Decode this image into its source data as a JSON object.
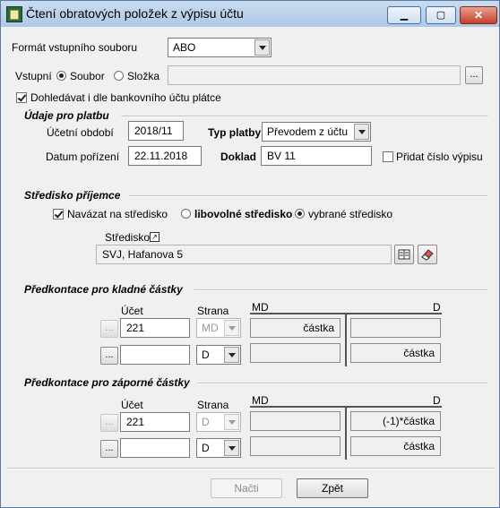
{
  "window": {
    "title": "Čtení obratových položek z výpisu účtu"
  },
  "format": {
    "label": "Formát vstupního souboru",
    "value": "ABO"
  },
  "input": {
    "label": "Vstupní",
    "opt_file": "Soubor",
    "opt_folder": "Složka",
    "path": "",
    "browse": "..."
  },
  "lookup_bank": {
    "label": "Dohledávat i dle bankovního účtu plátce",
    "checked": true
  },
  "payment": {
    "section": "Údaje pro platbu",
    "period_label": "Účetní období",
    "period": "2018/11",
    "type_label": "Typ platby",
    "type": "Převodem z účtu",
    "date_label": "Datum pořízení",
    "date": "22.11.2018",
    "doc_label": "Doklad",
    "doc": "BV 11",
    "add_stmt_label": "Přidat číslo výpisu",
    "add_stmt": false
  },
  "center": {
    "section": "Středisko příjemce",
    "link_label": "Navázat na středisko",
    "link": true,
    "opt_any": "libovolné středisko",
    "opt_selected": "vybrané středisko",
    "field_label": "Středisko",
    "field_value": "SVJ, Hafanova 5"
  },
  "positive": {
    "section": "Předkontace pro kladné částky",
    "ucet_label": "Účet",
    "strana_label": "Strana",
    "md_label": "MD",
    "d_label": "D",
    "rows": [
      {
        "btn": "...",
        "ucet": "221",
        "strana": "MD",
        "md": "částka",
        "d": ""
      },
      {
        "btn": "...",
        "ucet": "",
        "strana": "D",
        "md": "",
        "d": "částka"
      }
    ]
  },
  "negative": {
    "section": "Předkontace pro záporné částky",
    "ucet_label": "Účet",
    "strana_label": "Strana",
    "md_label": "MD",
    "d_label": "D",
    "rows": [
      {
        "btn": "...",
        "ucet": "221",
        "strana": "D",
        "md": "",
        "d": "(-1)*částka"
      },
      {
        "btn": "...",
        "ucet": "",
        "strana": "D",
        "md": "",
        "d": "částka"
      }
    ]
  },
  "buttons": {
    "load": "Načti",
    "back": "Zpět"
  }
}
